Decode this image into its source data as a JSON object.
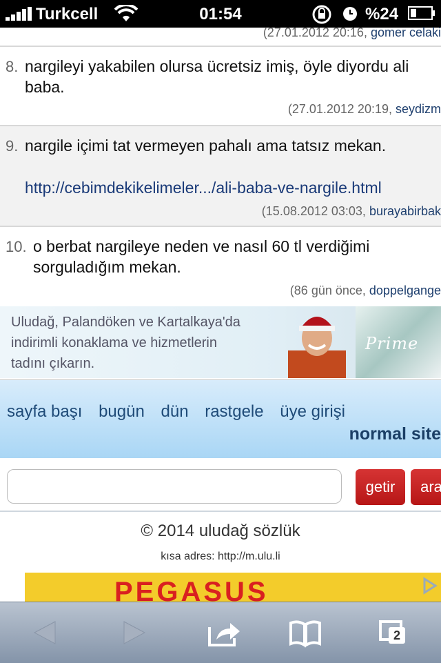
{
  "status_bar": {
    "carrier": "Turkcell",
    "time": "01:54",
    "battery_percent": "%24"
  },
  "entries": [
    {
      "number": "",
      "lines": [],
      "date": "(27.01.2012 20:16, ",
      "author": "gomer celaki"
    },
    {
      "number": "8.",
      "lines": [
        "nargileyi yakabilen olursa ücretsiz imiş, öyle diyordu ali",
        "baba."
      ],
      "date": "(27.01.2012 20:19, ",
      "author": "seydizm"
    },
    {
      "number": "9.",
      "lines": [
        "nargile içimi tat vermeyen pahalı ama tatsız mekan."
      ],
      "link": "http://cebimdekikelimeler.../ali-baba-ve-nargile.html",
      "date": "(15.08.2012 03:03, ",
      "author": "burayabirbak"
    },
    {
      "number": "10.",
      "lines": [
        "o berbat nargileye neden ve nasıl 60 tl verdiğimi",
        "sorguladığım mekan."
      ],
      "date": "(86 gün önce, ",
      "author": "doppelgange"
    }
  ],
  "ad_banner": {
    "line1": "Uludağ, Palandöken ve Kartalkaya'da",
    "line2": "indirimli konaklama ve hizmetlerin",
    "line3": "tadını çıkarın.",
    "brand": "Prime"
  },
  "nav": {
    "links": [
      "sayfa başı",
      "bugün",
      "dün",
      "rastgele",
      "üye girişi"
    ],
    "normal_site": "normal site"
  },
  "search": {
    "value": "",
    "placeholder": "",
    "getir": "getir",
    "ara": "ara"
  },
  "footer": {
    "copyright": "© 2014 uludağ sözlük",
    "short_address": "kısa adres: http://m.ulu.li",
    "ad_brand": "PEGASUS"
  },
  "toolbar": {
    "tab_count": "2"
  },
  "colors": {
    "accent_link": "#1a3a78",
    "button_red": "#c41f1f",
    "nav_blue": "#a9d6f5"
  }
}
